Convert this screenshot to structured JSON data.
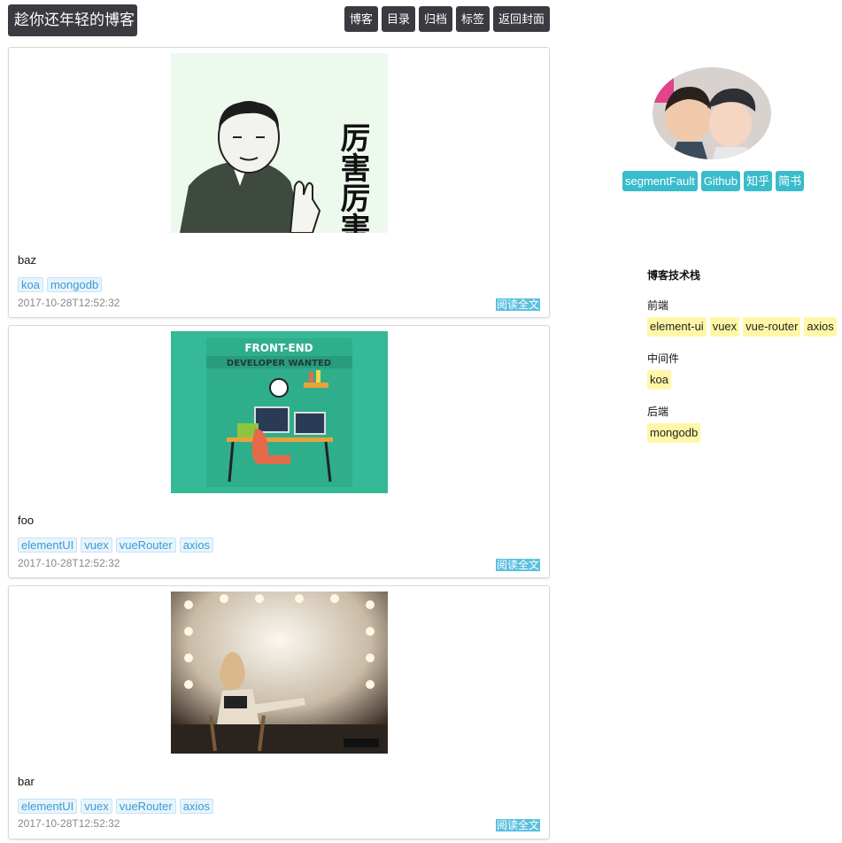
{
  "header": {
    "site_title": "趁你还年轻的博客",
    "nav": [
      "博客",
      "目录",
      "归档",
      "标签",
      "返回封面"
    ]
  },
  "posts": [
    {
      "image_text": "厉害厉害",
      "title": "baz",
      "tags": [
        "koa",
        "mongodb"
      ],
      "date": "2017-10-28T12:52:32",
      "read_more": "阅读全文"
    },
    {
      "image_text_line1": "FRONT-END",
      "image_text_line2": "DEVELOPER WANTED",
      "title": "foo",
      "tags": [
        "elementUI",
        "vuex",
        "vueRouter",
        "axios"
      ],
      "date": "2017-10-28T12:52:32",
      "read_more": "阅读全文"
    },
    {
      "title": "bar",
      "tags": [
        "elementUI",
        "vuex",
        "vueRouter",
        "axios"
      ],
      "date": "2017-10-28T12:52:32",
      "read_more": "阅读全文"
    }
  ],
  "sidebar": {
    "links": [
      "segmentFault",
      "Github",
      "知乎",
      "简书"
    ],
    "stack_title": "博客技术栈",
    "groups": [
      {
        "label": "前端",
        "items": [
          "element-ui",
          "vuex",
          "vue-router",
          "axios"
        ]
      },
      {
        "label": "中间件",
        "items": [
          "koa"
        ]
      },
      {
        "label": "后端",
        "items": [
          "mongodb"
        ]
      }
    ]
  },
  "colors": {
    "dark": "#3a3a40",
    "tag_bg": "#e8f4fc",
    "tag_text": "#3a9bd5",
    "read_more": "#5bc0de",
    "link_btn": "#39bccb",
    "stack_item": "#fff7a8"
  }
}
